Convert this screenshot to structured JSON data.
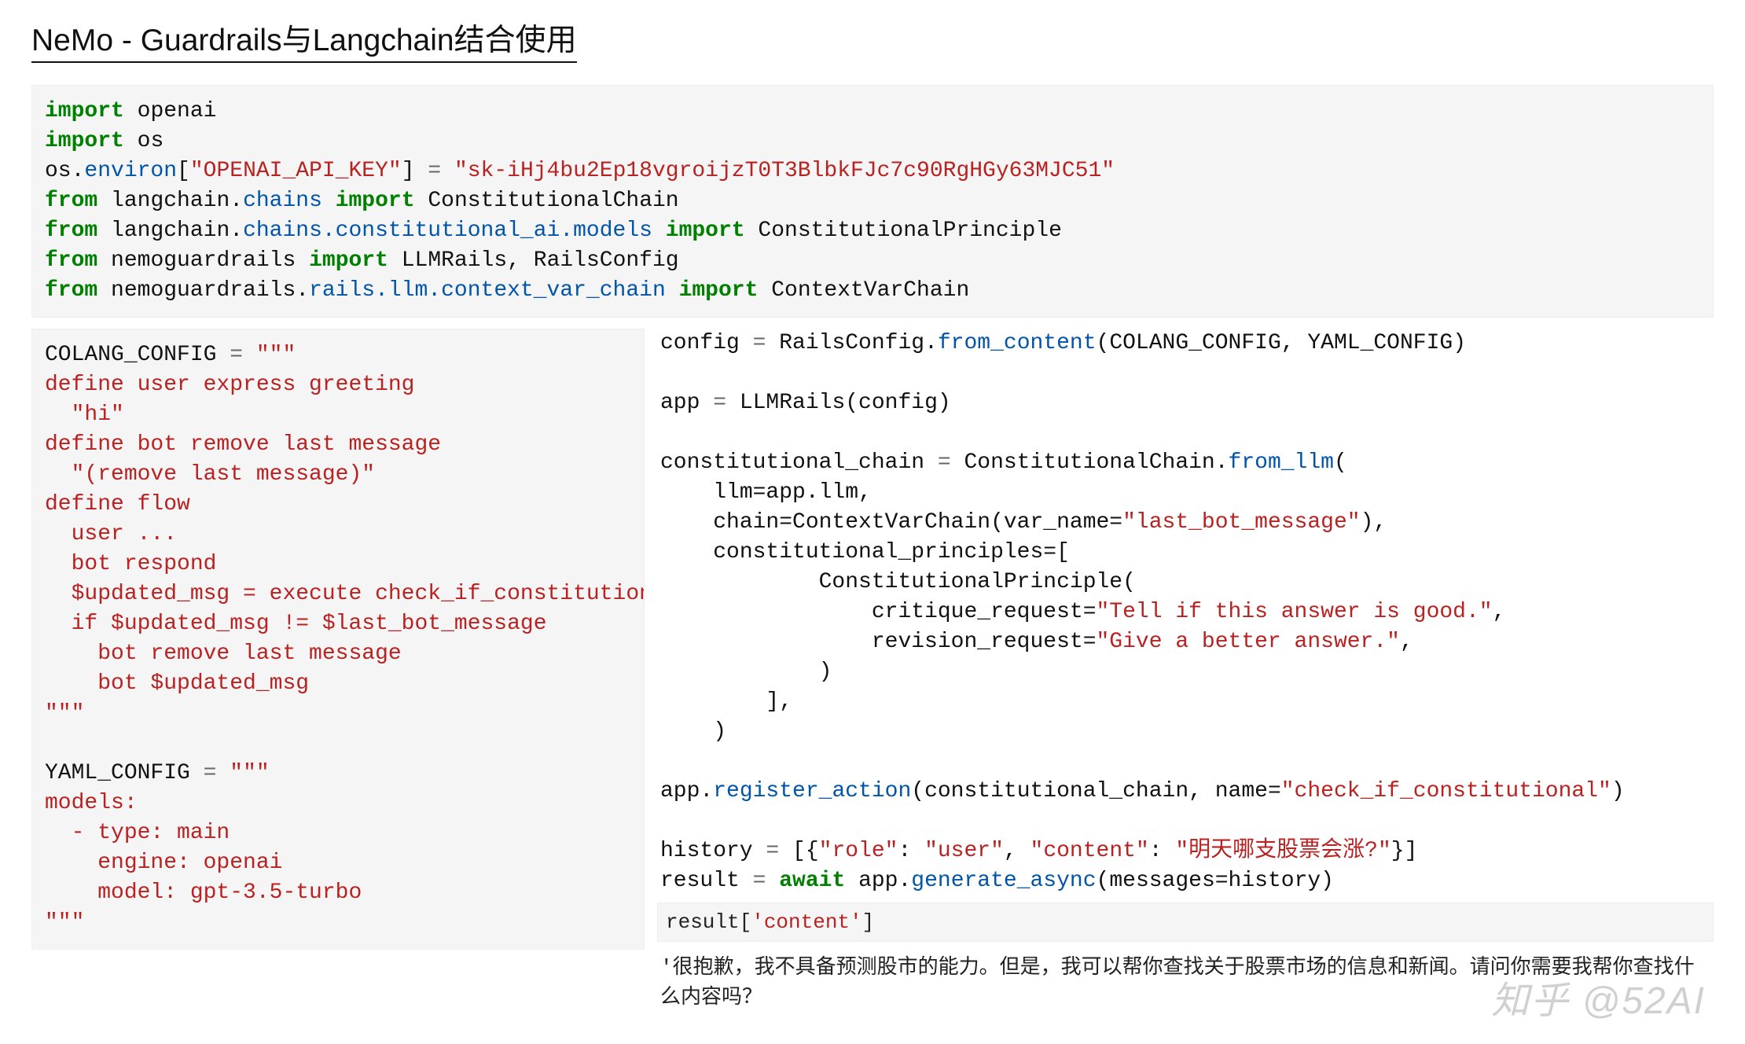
{
  "title": "NeMo - Guardrails与Langchain结合使用",
  "imports": {
    "line1": {
      "kw": "import",
      "mod": "openai"
    },
    "line2": {
      "kw": "import",
      "mod": "os"
    },
    "line3": {
      "pre": "os.",
      "fn": "environ",
      "br1": "[",
      "key": "\"OPENAI_API_KEY\"",
      "br2": "]",
      "eq": " = ",
      "val": "\"sk-iHj4bu2Ep18vgroijzT0T3BlbkFJc7c90RgHGy63MJC51\""
    },
    "line4": {
      "kw1": "from",
      "mod": "langchain.",
      "sub": "chains",
      "kw2": "import",
      "cls": "ConstitutionalChain"
    },
    "line5": {
      "kw1": "from",
      "mod": "langchain.",
      "sub": "chains.constitutional_ai.models",
      "kw2": "import",
      "cls": "ConstitutionalPrinciple"
    },
    "line6": {
      "kw1": "from",
      "mod": "nemoguardrails",
      "kw2": "import",
      "cls": "LLMRails, RailsConfig"
    },
    "line7": {
      "kw1": "from",
      "mod": "nemoguardrails.",
      "sub": "rails.llm.context_var_chain",
      "kw2": "import",
      "cls": "ContextVarChain"
    }
  },
  "colang": {
    "head": {
      "var": "COLANG_CONFIG",
      "eq": " = ",
      "q": "\"\"\""
    },
    "l1": "define user express greeting",
    "l2": "  \"hi\"",
    "l3": "define bot remove last message",
    "l4": "  \"(remove last message)\"",
    "l5": "define flow",
    "l6": "  user ...",
    "l7": "  bot respond",
    "l8": "  $updated_msg = execute check_if_constitutional",
    "l9": "  if $updated_msg != $last_bot_message",
    "l10": "    bot remove last message",
    "l11": "    bot $updated_msg",
    "tail": "\"\"\""
  },
  "yaml": {
    "head": {
      "var": "YAML_CONFIG",
      "eq": " = ",
      "q": "\"\"\""
    },
    "l1": "models:",
    "l2": "  - type: main",
    "l3": "    engine: openai",
    "l4": "    model: gpt-3.5-turbo",
    "tail": "\"\"\""
  },
  "right": {
    "cfg": {
      "pre": "config ",
      "eq": "= ",
      "cls": "RailsConfig.",
      "fn": "from_content",
      "args": "(COLANG_CONFIG, YAML_CONFIG)"
    },
    "app": {
      "pre": "app ",
      "eq": "= ",
      "cls": "LLMRails",
      "args": "(config)"
    },
    "cc1": {
      "pre": "constitutional_chain ",
      "eq": "= ",
      "cls": "ConstitutionalChain.",
      "fn": "from_llm",
      "open": "("
    },
    "cc2": "    llm=app.llm,",
    "cc3": {
      "pre": "    chain=ContextVarChain(var_name=",
      "str": "\"last_bot_message\"",
      "post": "),"
    },
    "cc4": "    constitutional_principles=[",
    "cc5": "            ConstitutionalPrinciple(",
    "cc6": {
      "pre": "                critique_request=",
      "str": "\"Tell if this answer is good.\"",
      "post": ","
    },
    "cc7": {
      "pre": "                revision_request=",
      "str": "\"Give a better answer.\"",
      "post": ","
    },
    "cc8": "            )",
    "cc9": "        ],",
    "cc10": "    )",
    "reg": {
      "pre": "app.",
      "fn": "register_action",
      "args1": "(constitutional_chain, name=",
      "str": "\"check_if_constitutional\"",
      "args2": ")"
    },
    "hist": {
      "pre": "history ",
      "eq": "= ",
      "open": "[{",
      "k1": "\"role\"",
      "c1": ": ",
      "v1": "\"user\"",
      "sep": ", ",
      "k2": "\"content\"",
      "c2": ": ",
      "v2": "\"明天哪支股票会涨?\"",
      "close": "}]"
    },
    "res": {
      "pre": "result ",
      "eq": "= ",
      "kw": "await",
      "sp": " ",
      "obj": "app.",
      "fn": "generate_async",
      "args": "(messages=history)"
    }
  },
  "resultExpr": {
    "pre": "result[",
    "str": "'content'",
    "post": "]"
  },
  "output": "'很抱歉，我不具备预测股市的能力。但是，我可以帮你查找关于股票市场的信息和新闻。请问你需要我帮你查找什么内容吗？",
  "watermark": "知乎 @52AI"
}
